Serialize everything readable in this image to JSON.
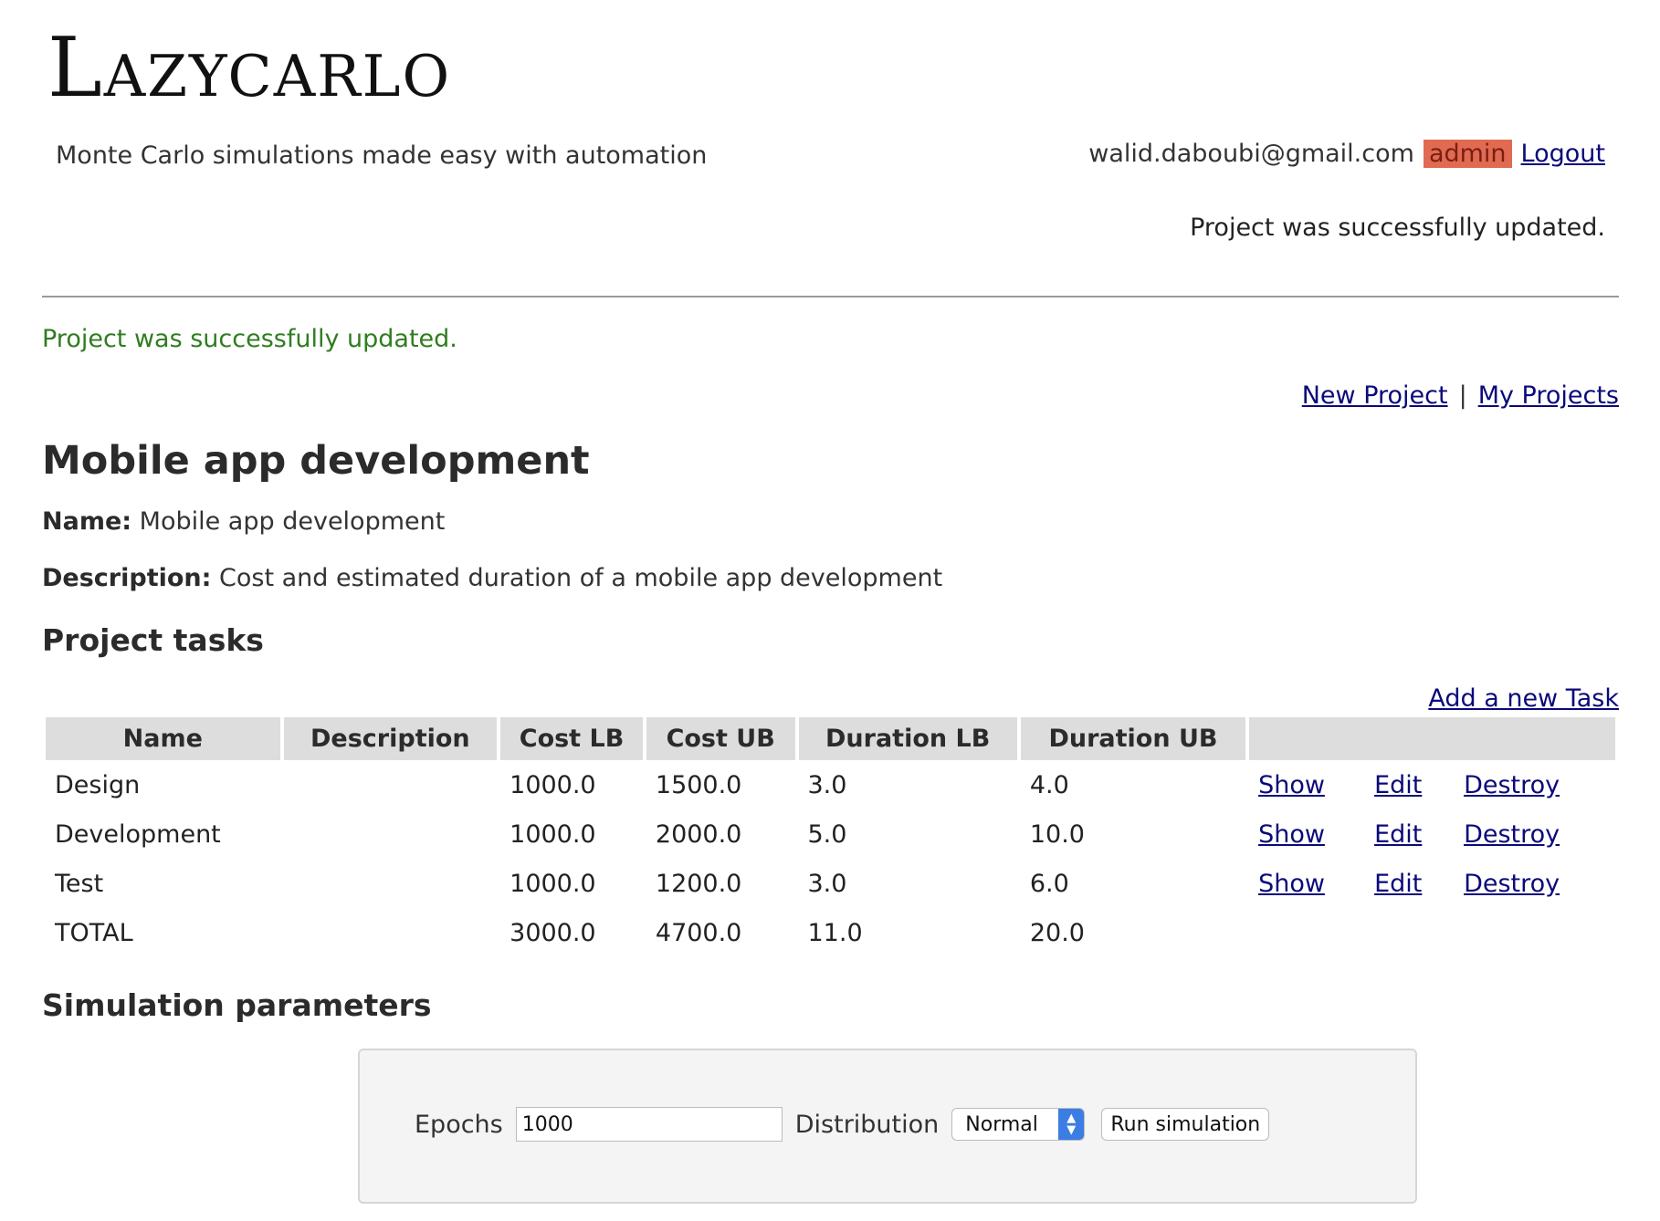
{
  "header": {
    "logo": "Lazycarlo",
    "tagline": "Monte Carlo simulations made easy with automation",
    "user_email": "walid.daboubi@gmail.com",
    "role_badge": "admin",
    "logout_label": "Logout",
    "notice_right": "Project was successfully updated."
  },
  "notice": "Project was successfully updated.",
  "links": {
    "new_project": "New Project",
    "separator": "|",
    "my_projects": "My Projects"
  },
  "project": {
    "title": "Mobile app development",
    "name_label": "Name:",
    "name": "Mobile app development",
    "description_label": "Description:",
    "description": "Cost and estimated duration of a mobile app development"
  },
  "tasks_section": {
    "heading": "Project tasks",
    "add_task_label": "Add a new Task",
    "columns": [
      "Name",
      "Description",
      "Cost LB",
      "Cost UB",
      "Duration LB",
      "Duration UB",
      ""
    ],
    "rows": [
      {
        "name": "Design",
        "description": "",
        "cost_lb": "1000.0",
        "cost_ub": "1500.0",
        "duration_lb": "3.0",
        "duration_ub": "4.0",
        "show": "Show",
        "edit": "Edit",
        "destroy": "Destroy"
      },
      {
        "name": "Development",
        "description": "",
        "cost_lb": "1000.0",
        "cost_ub": "2000.0",
        "duration_lb": "5.0",
        "duration_ub": "10.0",
        "show": "Show",
        "edit": "Edit",
        "destroy": "Destroy"
      },
      {
        "name": "Test",
        "description": "",
        "cost_lb": "1000.0",
        "cost_ub": "1200.0",
        "duration_lb": "3.0",
        "duration_ub": "6.0",
        "show": "Show",
        "edit": "Edit",
        "destroy": "Destroy"
      }
    ],
    "total": {
      "name": "TOTAL",
      "cost_lb": "3000.0",
      "cost_ub": "4700.0",
      "duration_lb": "11.0",
      "duration_ub": "20.0"
    }
  },
  "simulation": {
    "heading": "Simulation parameters",
    "epochs_label": "Epochs",
    "epochs_value": "1000",
    "distribution_label": "Distribution",
    "distribution_value": "Normal",
    "run_label": "Run simulation"
  },
  "colors": {
    "badge_bg": "#e06b52",
    "notice_green": "#2f7d20",
    "link": "#0a0a7a",
    "select_accent": "#3b7de3"
  }
}
